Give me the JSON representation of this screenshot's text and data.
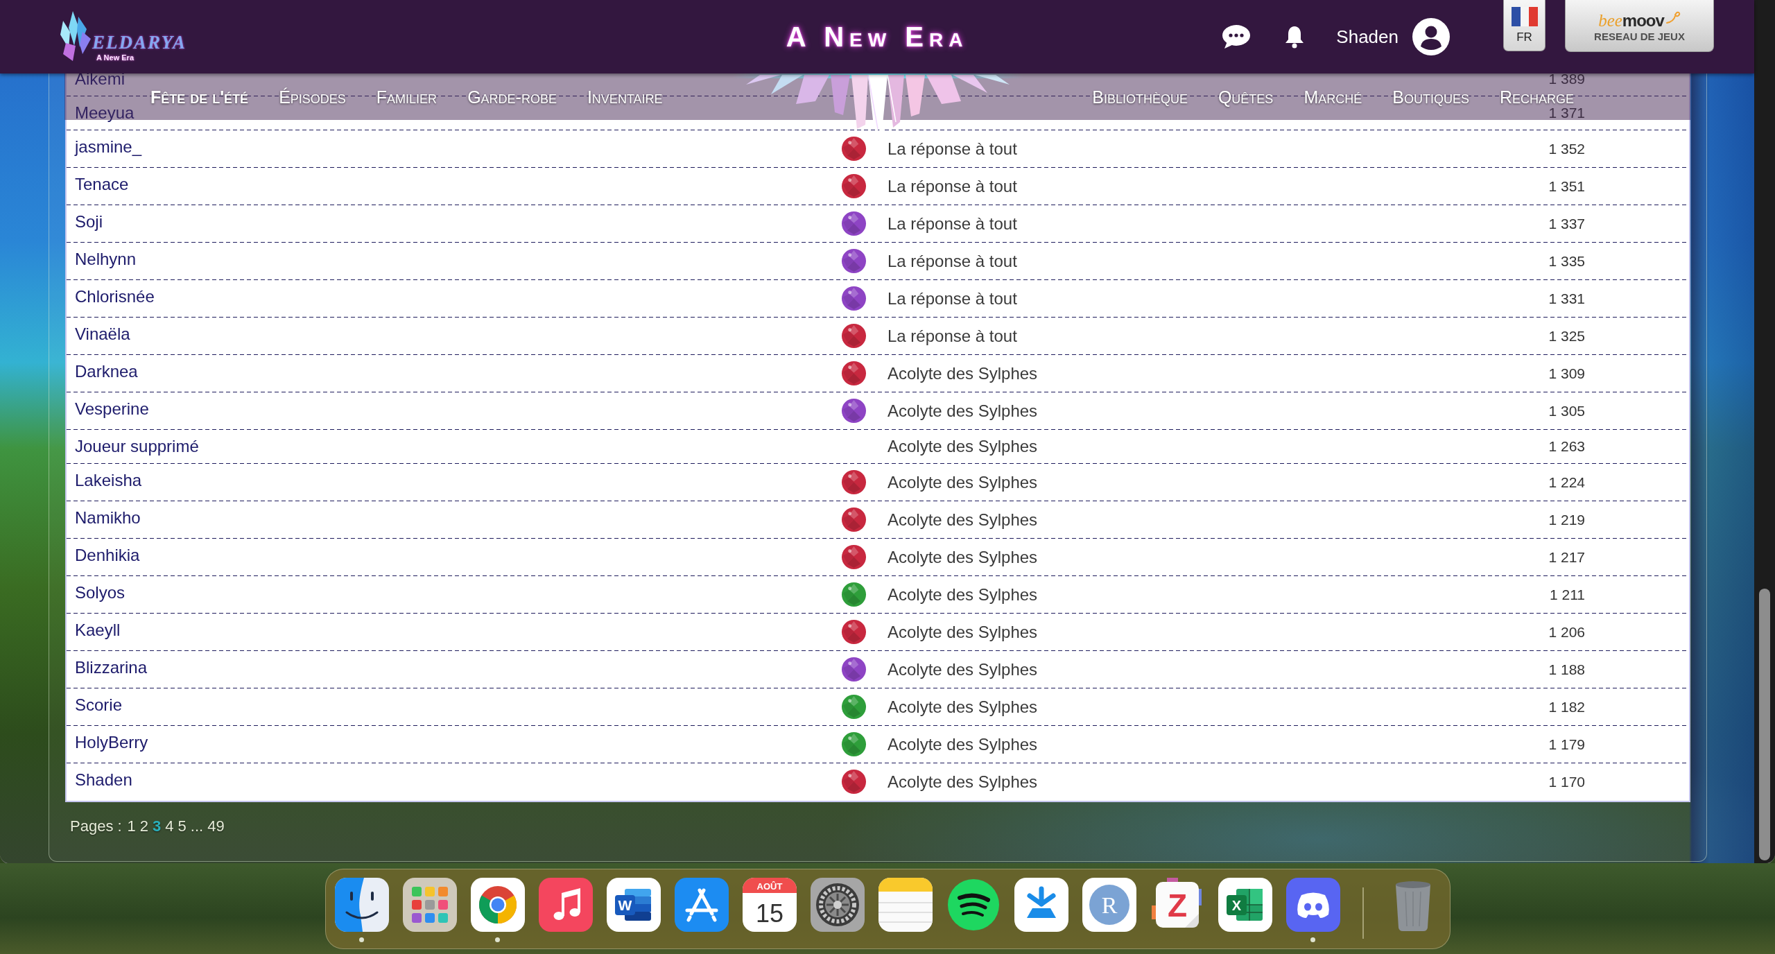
{
  "header": {
    "logo": {
      "wordmark": "ELDARYA",
      "tagline": "A New Era"
    },
    "title": "A New Era",
    "username": "Shaden",
    "language": "FR",
    "partner": {
      "name_start": "bee",
      "name_end": "moov",
      "subtitle": "RESEAU DE JEUX"
    }
  },
  "nav": {
    "left": [
      {
        "label": "Fête de l'été",
        "selected": true
      },
      {
        "label": "Épisodes",
        "selected": false
      },
      {
        "label": "Familier",
        "selected": false
      },
      {
        "label": "Garde-robe",
        "selected": false
      },
      {
        "label": "Inventaire",
        "selected": false
      }
    ],
    "right": [
      {
        "label": "Bibliothèque",
        "selected": false
      },
      {
        "label": "Quêtes",
        "selected": false
      },
      {
        "label": "Marché",
        "selected": false
      },
      {
        "label": "Boutiques",
        "selected": false
      },
      {
        "label": "Recharge",
        "selected": false
      }
    ]
  },
  "leaderboard": {
    "rows": [
      {
        "name": "Aikemi",
        "score": "1 389"
      },
      {
        "name": "Meeyua",
        "score": "1 371"
      },
      {
        "name": "jasmine_",
        "color": "#c8283f",
        "title": "La réponse à tout",
        "score": "1 352"
      },
      {
        "name": "Tenace",
        "color": "#c8283f",
        "title": "La réponse à tout",
        "score": "1 351"
      },
      {
        "name": "Soji",
        "color": "#8e44c4",
        "title": "La réponse à tout",
        "score": "1 337"
      },
      {
        "name": "Nelhynn",
        "color": "#8e44c4",
        "title": "La réponse à tout",
        "score": "1 335"
      },
      {
        "name": "Chlorisnée",
        "color": "#8e44c4",
        "title": "La réponse à tout",
        "score": "1 331"
      },
      {
        "name": "Vinaëla",
        "color": "#c8283f",
        "title": "La réponse à tout",
        "score": "1 325"
      },
      {
        "name": "Darknea",
        "color": "#c8283f",
        "title": "Acolyte des Sylphes",
        "score": "1 309"
      },
      {
        "name": "Vesperine",
        "color": "#8e44c4",
        "title": "Acolyte des Sylphes",
        "score": "1 305"
      },
      {
        "name": "Joueur supprimé",
        "title": "Acolyte des Sylphes",
        "score": "1 263"
      },
      {
        "name": "Lakeisha",
        "color": "#c8283f",
        "title": "Acolyte des Sylphes",
        "score": "1 224"
      },
      {
        "name": "Namikho",
        "color": "#c8283f",
        "title": "Acolyte des Sylphes",
        "score": "1 219"
      },
      {
        "name": "Denhikia",
        "color": "#c8283f",
        "title": "Acolyte des Sylphes",
        "score": "1 217"
      },
      {
        "name": "Solyos",
        "color": "#2e9e3a",
        "title": "Acolyte des Sylphes",
        "score": "1 211"
      },
      {
        "name": "Kaeyll",
        "color": "#c8283f",
        "title": "Acolyte des Sylphes",
        "score": "1 206"
      },
      {
        "name": "Blizzarina",
        "color": "#8e44c4",
        "title": "Acolyte des Sylphes",
        "score": "1 188"
      },
      {
        "name": "Scorie",
        "color": "#2e9e3a",
        "title": "Acolyte des Sylphes",
        "score": "1 182"
      },
      {
        "name": "HolyBerry",
        "color": "#2e9e3a",
        "title": "Acolyte des Sylphes",
        "score": "1 179"
      },
      {
        "name": "Shaden",
        "color": "#c8283f",
        "title": "Acolyte des Sylphes",
        "score": "1 170"
      }
    ]
  },
  "pagination": {
    "label": "Pages :",
    "pages": [
      {
        "label": "1",
        "selected": false
      },
      {
        "label": "2",
        "selected": false
      },
      {
        "label": "3",
        "selected": true
      },
      {
        "label": "4",
        "selected": false
      },
      {
        "label": "5",
        "selected": false
      }
    ],
    "ellipsis": "...",
    "last_page": {
      "label": "49",
      "selected": false
    }
  },
  "dock": {
    "items": [
      {
        "kind": "face",
        "running": true
      },
      {
        "kind": "grid",
        "running": false
      },
      {
        "kind": "ring",
        "running": true
      },
      {
        "kind": "note",
        "running": false
      },
      {
        "kind": "doc",
        "label": "W",
        "running": false
      },
      {
        "kind": "a",
        "running": false
      },
      {
        "kind": "calendar",
        "month": "AOÛT",
        "day": "15",
        "running": false
      },
      {
        "kind": "gear",
        "running": false
      },
      {
        "kind": "notepad",
        "running": false
      },
      {
        "kind": "waves",
        "running": false
      },
      {
        "kind": "asterisk",
        "running": false
      },
      {
        "kind": "letter-circle",
        "label": "R",
        "running": false
      },
      {
        "kind": "letter-page",
        "label": "Z",
        "running": false
      },
      {
        "kind": "sheet",
        "label": "X",
        "running": false
      },
      {
        "kind": "controller",
        "running": true
      },
      {
        "kind": "trash",
        "running": false
      }
    ]
  }
}
